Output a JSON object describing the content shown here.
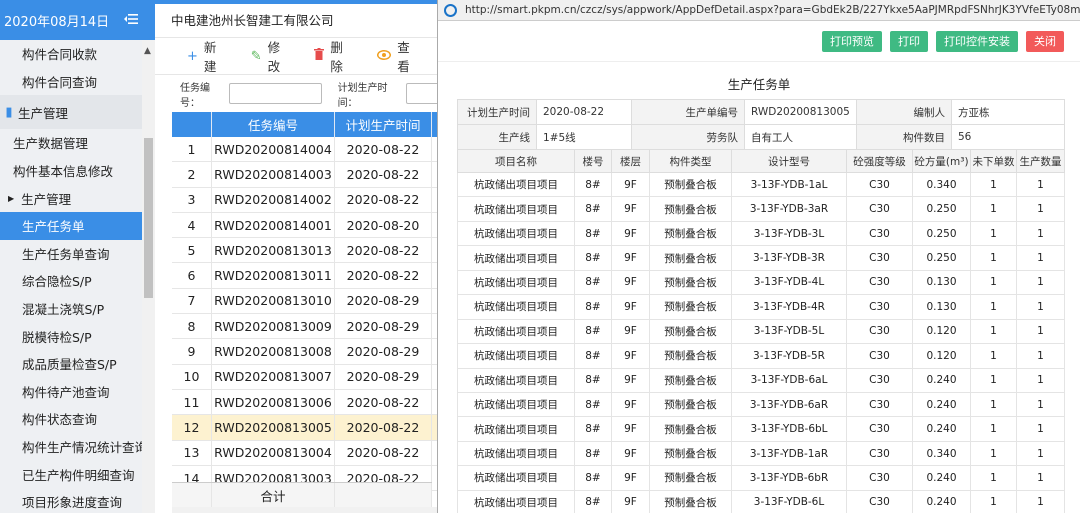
{
  "sidebar": {
    "date": "2020年08月14日",
    "items": [
      {
        "label": "构件合同收款",
        "kind": "l2"
      },
      {
        "label": "构件合同查询",
        "kind": "l2"
      },
      {
        "label": "生产管理",
        "kind": "group"
      },
      {
        "label": "生产数据管理",
        "kind": "l1"
      },
      {
        "label": "构件基本信息修改",
        "kind": "l1"
      },
      {
        "label": "生产管理",
        "kind": "expand"
      },
      {
        "label": "生产任务单",
        "kind": "l2",
        "active": true
      },
      {
        "label": "生产任务单查询",
        "kind": "l2"
      },
      {
        "label": "综合隐检S/P",
        "kind": "l2"
      },
      {
        "label": "混凝土浇筑S/P",
        "kind": "l2"
      },
      {
        "label": "脱模待检S/P",
        "kind": "l2"
      },
      {
        "label": "成品质量检查S/P",
        "kind": "l2"
      },
      {
        "label": "构件待产池查询",
        "kind": "l2"
      },
      {
        "label": "构件状态查询",
        "kind": "l2"
      },
      {
        "label": "构件生产情况统计查询",
        "kind": "l2"
      },
      {
        "label": "已生产构件明细查询",
        "kind": "l2"
      },
      {
        "label": "项目形象进度查询",
        "kind": "l2"
      }
    ]
  },
  "mid": {
    "company": "中电建池州长智建工有限公司",
    "toolbar": {
      "add": "新建",
      "edit": "修改",
      "delete": "删除",
      "view": "查看"
    },
    "filter": {
      "task_no_label": "任务编号：",
      "plan_date_label": "计划生产时间："
    },
    "columns": {
      "no": "任务编号",
      "date": "计划生产时间"
    },
    "rows": [
      {
        "idx": "1",
        "no": "RWD20200814004",
        "date": "2020-08-22"
      },
      {
        "idx": "2",
        "no": "RWD20200814003",
        "date": "2020-08-22"
      },
      {
        "idx": "3",
        "no": "RWD20200814002",
        "date": "2020-08-22"
      },
      {
        "idx": "4",
        "no": "RWD20200814001",
        "date": "2020-08-20"
      },
      {
        "idx": "5",
        "no": "RWD20200813013",
        "date": "2020-08-22"
      },
      {
        "idx": "6",
        "no": "RWD20200813011",
        "date": "2020-08-22"
      },
      {
        "idx": "7",
        "no": "RWD20200813010",
        "date": "2020-08-29"
      },
      {
        "idx": "8",
        "no": "RWD20200813009",
        "date": "2020-08-29"
      },
      {
        "idx": "9",
        "no": "RWD20200813008",
        "date": "2020-08-29"
      },
      {
        "idx": "10",
        "no": "RWD20200813007",
        "date": "2020-08-29"
      },
      {
        "idx": "11",
        "no": "RWD20200813006",
        "date": "2020-08-22"
      },
      {
        "idx": "12",
        "no": "RWD20200813005",
        "date": "2020-08-22",
        "selected": true
      },
      {
        "idx": "13",
        "no": "RWD20200813004",
        "date": "2020-08-22"
      },
      {
        "idx": "14",
        "no": "RWD20200813003",
        "date": "2020-08-22"
      }
    ],
    "footer": "合计"
  },
  "window": {
    "url": "http://smart.pkpm.cn/czcz/sys/appwork/AppDefDetail.aspx?para=GbdEk2B/227Ykxe5AaPJMRpdFSNhrJK3YVfeETy08mDPGXvf1Fg3",
    "buttons": {
      "preview": "打印预览",
      "print": "打印",
      "install": "打印控件安装",
      "close": "关闭"
    },
    "title": "生产任务单",
    "info": {
      "plan_date_label": "计划生产时间",
      "plan_date": "2020-08-22",
      "task_no_label": "生产单编号",
      "task_no": "RWD20200813005",
      "author_label": "编制人",
      "author": "方亚栋",
      "line_label": "生产线",
      "line": "1#5线",
      "team_label": "劳务队",
      "team": "自有工人",
      "count_label": "构件数目",
      "count": "56"
    },
    "columns": [
      "项目名称",
      "楼号",
      "楼层",
      "构件类型",
      "设计型号",
      "砼强度等级",
      "砼方量(m³)",
      "未下单数",
      "生产数量"
    ],
    "rows": [
      [
        "杭政储出项目项目",
        "8#",
        "9F",
        "预制叠合板",
        "3-13F-YDB-1aL",
        "C30",
        "0.340",
        "1",
        "1"
      ],
      [
        "杭政储出项目项目",
        "8#",
        "9F",
        "预制叠合板",
        "3-13F-YDB-3aR",
        "C30",
        "0.250",
        "1",
        "1"
      ],
      [
        "杭政储出项目项目",
        "8#",
        "9F",
        "预制叠合板",
        "3-13F-YDB-3L",
        "C30",
        "0.250",
        "1",
        "1"
      ],
      [
        "杭政储出项目项目",
        "8#",
        "9F",
        "预制叠合板",
        "3-13F-YDB-3R",
        "C30",
        "0.250",
        "1",
        "1"
      ],
      [
        "杭政储出项目项目",
        "8#",
        "9F",
        "预制叠合板",
        "3-13F-YDB-4L",
        "C30",
        "0.130",
        "1",
        "1"
      ],
      [
        "杭政储出项目项目",
        "8#",
        "9F",
        "预制叠合板",
        "3-13F-YDB-4R",
        "C30",
        "0.130",
        "1",
        "1"
      ],
      [
        "杭政储出项目项目",
        "8#",
        "9F",
        "预制叠合板",
        "3-13F-YDB-5L",
        "C30",
        "0.120",
        "1",
        "1"
      ],
      [
        "杭政储出项目项目",
        "8#",
        "9F",
        "预制叠合板",
        "3-13F-YDB-5R",
        "C30",
        "0.120",
        "1",
        "1"
      ],
      [
        "杭政储出项目项目",
        "8#",
        "9F",
        "预制叠合板",
        "3-13F-YDB-6aL",
        "C30",
        "0.240",
        "1",
        "1"
      ],
      [
        "杭政储出项目项目",
        "8#",
        "9F",
        "预制叠合板",
        "3-13F-YDB-6aR",
        "C30",
        "0.240",
        "1",
        "1"
      ],
      [
        "杭政储出项目项目",
        "8#",
        "9F",
        "预制叠合板",
        "3-13F-YDB-6bL",
        "C30",
        "0.240",
        "1",
        "1"
      ],
      [
        "杭政储出项目项目",
        "8#",
        "9F",
        "预制叠合板",
        "3-13F-YDB-1aR",
        "C30",
        "0.340",
        "1",
        "1"
      ],
      [
        "杭政储出项目项目",
        "8#",
        "9F",
        "预制叠合板",
        "3-13F-YDB-6bR",
        "C30",
        "0.240",
        "1",
        "1"
      ],
      [
        "杭政储出项目项目",
        "8#",
        "9F",
        "预制叠合板",
        "3-13F-YDB-6L",
        "C30",
        "0.240",
        "1",
        "1"
      ]
    ]
  },
  "colors": {
    "accent": "#3a8ee6",
    "green_button": "#3fba83",
    "red_button": "#f25a5a",
    "selected_row": "#fdf2d0"
  }
}
